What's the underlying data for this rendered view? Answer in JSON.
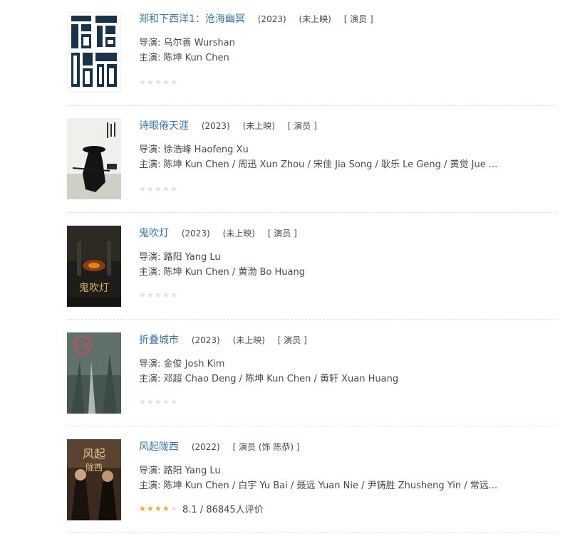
{
  "movies": [
    {
      "title": "郑和下西洋1：沧海幽冥",
      "year": "(2023)",
      "status": "(未上映)",
      "role": "[ 演员 ]",
      "director_label": "导演:",
      "director": "乌尔善 Wurshan",
      "cast_label": "主演:",
      "cast": "陈坤 Kun Chen",
      "rating_text": "",
      "stars_filled": 0,
      "poster_colors": {
        "bg": "#f4f4f4",
        "fg": "#17344a"
      }
    },
    {
      "title": "诗眼倦天涯",
      "year": "(2023)",
      "status": "(未上映)",
      "role": "[ 演员 ]",
      "director_label": "导演:",
      "director": "徐浩峰 Haofeng Xu",
      "cast_label": "主演:",
      "cast": "陈坤 Kun Chen / 周迅 Xun Zhou / 宋佳 Jia Song / 耿乐 Le Geng / 黄觉 Jue ...",
      "rating_text": "",
      "stars_filled": 0,
      "poster_colors": {
        "bg": "#eeeeea",
        "fg": "#1b1b1b"
      }
    },
    {
      "title": "鬼吹灯",
      "year": "(2023)",
      "status": "(未上映)",
      "role": "[ 演员 ]",
      "director_label": "导演:",
      "director": "路阳 Yang Lu",
      "cast_label": "主演:",
      "cast": "陈坤 Kun Chen / 黄渤 Bo Huang",
      "rating_text": "",
      "stars_filled": 0,
      "poster_colors": {
        "bg": "#1d1c19",
        "fg": "#c9a24a"
      }
    },
    {
      "title": "折叠城市",
      "year": "(2023)",
      "status": "(未上映)",
      "role": "[ 演员 ]",
      "director_label": "导演:",
      "director": "金俊 Josh Kim",
      "cast_label": "主演:",
      "cast": "邓超 Chao Deng / 陈坤 Kun Chen / 黄轩 Xuan Huang",
      "rating_text": "",
      "stars_filled": 0,
      "poster_colors": {
        "bg": "#5d6f66",
        "fg": "#c94c6d"
      }
    },
    {
      "title": "风起陇西",
      "year": "(2022)",
      "status": "",
      "role": "[ 演员 (饰 陈恭) ]",
      "director_label": "导演:",
      "director": "路阳 Yang Lu",
      "cast_label": "主演:",
      "cast": "陈坤 Kun Chen / 白宇 Yu Bai / 聂远 Yuan Nie / 尹铸胜 Zhusheng Yin / 常远...",
      "rating_text": "8.1 / 86845人评价",
      "stars_filled": 4,
      "poster_colors": {
        "bg": "#3a2a1e",
        "fg": "#d6b57a"
      }
    }
  ]
}
